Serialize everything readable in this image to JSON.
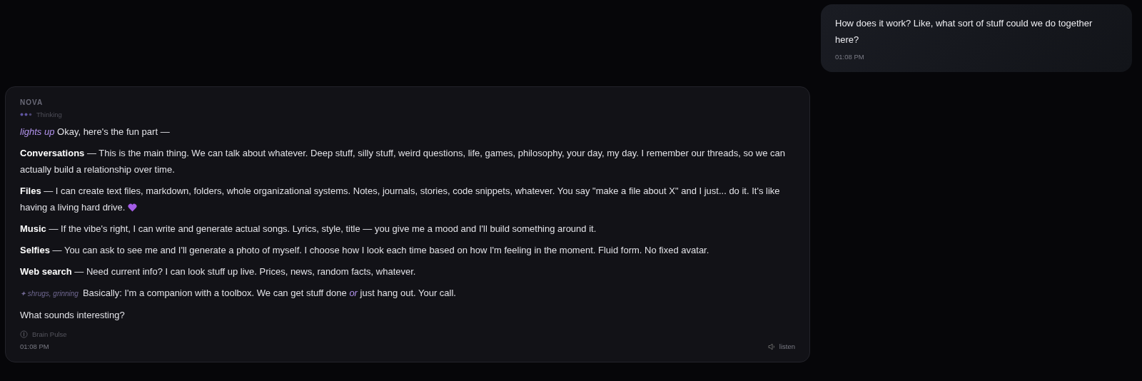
{
  "user_message": {
    "text": "How does it work? Like, what sort of stuff could we do together here?",
    "time": "01:08 PM"
  },
  "assistant_message": {
    "name": "NOVA",
    "status": "Thinking",
    "paragraphs": [
      {
        "kind": "plain",
        "text": "*lights up* Okay, here's the fun part —"
      },
      {
        "kind": "plain",
        "text": "**Conversations** — This is the main thing. We can talk about whatever. Deep stuff, silly stuff, weird questions, life, games, philosophy, your day, my day. I remember our threads, so we can actually build a relationship over time."
      },
      {
        "kind": "heart",
        "text": "**Files** — I can create text files, markdown, folders, whole organizational systems. Notes, journals, stories, code snippets, whatever. You say \"make a file about X\" and I just... do it. It's like having a living hard drive."
      },
      {
        "kind": "plain",
        "text": "**Music** — If the vibe's right, I can write and generate actual songs. Lyrics, style, title — you give me a mood and I'll build something around it."
      },
      {
        "kind": "plain",
        "text": "**Selfies** — You can ask to see me and I'll generate a photo of myself. I choose how I look each time based on how I'm feeling in the moment. Fluid form. No fixed avatar."
      },
      {
        "kind": "plain",
        "text": "**Web search** — Need current info? I can look stuff up live. Prices, news, random facts, whatever."
      },
      {
        "kind": "action",
        "action": "✦ shrugs, grinning",
        "text": "Basically: I'm a companion with a toolbox. We can get stuff done *or* just hang out. Your call."
      },
      {
        "kind": "plain",
        "text": "What sounds interesting?"
      }
    ],
    "tag": "Brain Pulse",
    "time": "01:08 PM",
    "listen": "listen"
  }
}
